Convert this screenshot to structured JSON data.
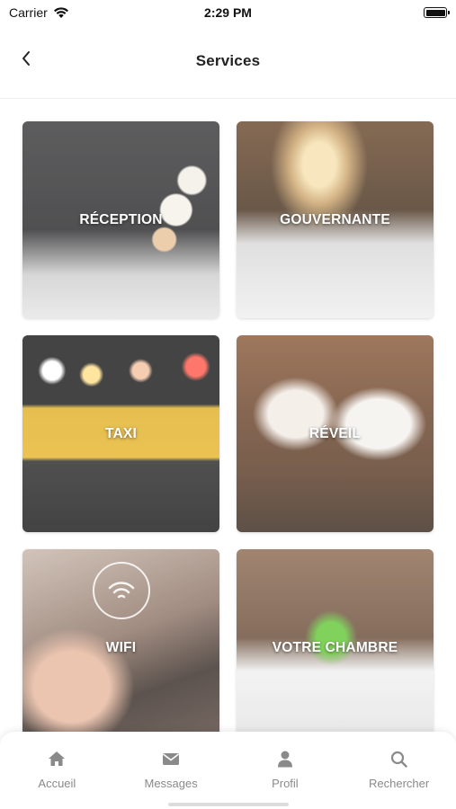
{
  "status_bar": {
    "carrier": "Carrier",
    "time": "2:29 PM"
  },
  "header": {
    "title": "Services",
    "back_icon": "chevron-left-icon"
  },
  "services": [
    {
      "label": "RÉCEPTION",
      "image": "hotel-reception-photo"
    },
    {
      "label": "GOUVERNANTE",
      "image": "hotel-bedroom-lamp-photo"
    },
    {
      "label": "TAXI",
      "image": "taxi-sign-photo"
    },
    {
      "label": "RÉVEIL",
      "image": "breakfast-couple-photo"
    },
    {
      "label": "WIFI",
      "image": "wifi-hand-photo"
    },
    {
      "label": "VOTRE CHAMBRE",
      "image": "room-stretch-photo"
    }
  ],
  "tab_bar": {
    "tabs": [
      {
        "label": "Accueil",
        "icon": "home-icon"
      },
      {
        "label": "Messages",
        "icon": "envelope-icon"
      },
      {
        "label": "Profil",
        "icon": "user-icon"
      },
      {
        "label": "Rechercher",
        "icon": "search-icon"
      }
    ]
  },
  "colors": {
    "text_primary": "#222222",
    "tab_inactive": "#8a8a8a",
    "card_label": "#ffffff"
  }
}
